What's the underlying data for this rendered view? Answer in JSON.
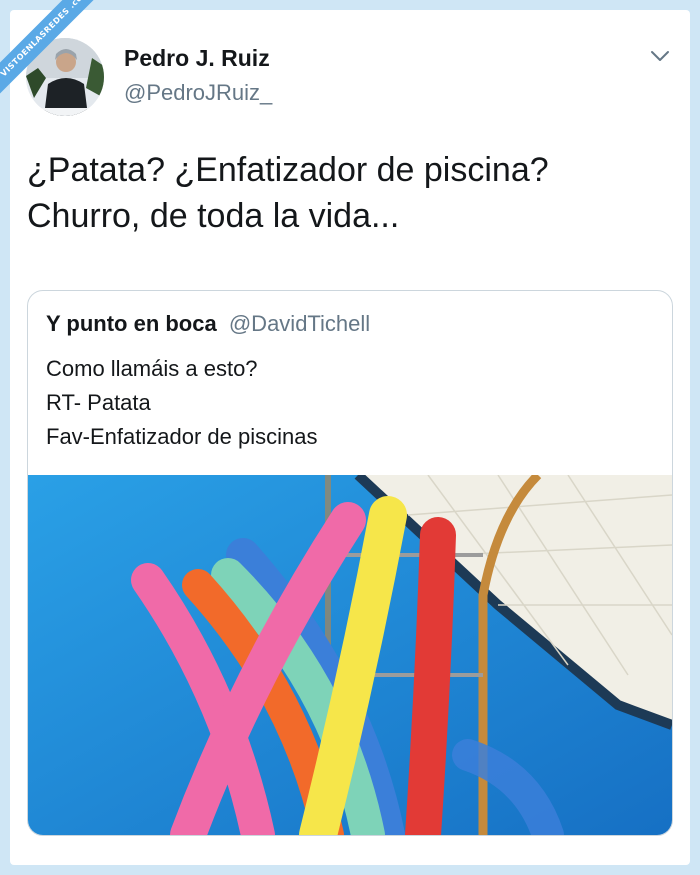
{
  "watermark": {
    "text": "VISTOENLASREDES .com"
  },
  "tweet": {
    "author": {
      "name": "Pedro J. Ruiz",
      "handle": "@PedroJRuiz_"
    },
    "menu_icon": "chevron-down-icon",
    "text": "¿Patata? ¿Enfatizador de piscina?\nChurro, de toda la vida..."
  },
  "quoted_tweet": {
    "author": {
      "name": "Y punto en boca",
      "handle": "@DavidTichell"
    },
    "text": "Como llamáis a esto?\nRT- Patata\nFav-Enfatizador de piscinas",
    "media": {
      "description_icon": "photo-pool-noodles",
      "colors": {
        "water": "#1f8ed6",
        "pink": "#f06aa8",
        "orange": "#f26a2a",
        "mint": "#7ed3b8",
        "blue": "#3b7fd9",
        "yellow": "#f6e64a",
        "red": "#e23a36"
      }
    }
  },
  "colors": {
    "page_bg": "#cfe6f5",
    "banner": "#5aa9e6",
    "text": "#14171a",
    "secondary": "#657786",
    "border": "#ccd6dd"
  }
}
